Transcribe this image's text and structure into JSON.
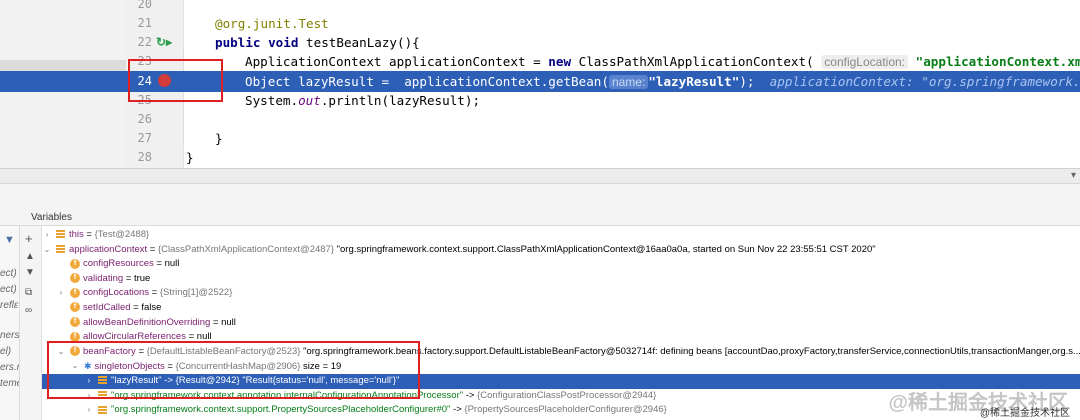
{
  "editor": {
    "lines": [
      {
        "num": "20"
      },
      {
        "num": "21"
      },
      {
        "num": "22"
      },
      {
        "num": "23"
      },
      {
        "num": "24"
      },
      {
        "num": "25"
      },
      {
        "num": "26"
      },
      {
        "num": "27"
      },
      {
        "num": "28"
      }
    ],
    "l21_annotation": "@org.junit.Test",
    "l22_kw1": "public",
    "l22_kw2": "void",
    "l22_rest": "testBeanLazy(){",
    "l23_a": "ApplicationContext applicationContext = ",
    "l23_kw": "new",
    "l23_b": " ClassPathXmlApplicationContext(",
    "l23_hint": "configLocation:",
    "l23_str": "\"applicationContext.xml\"",
    "l23_end": ");",
    "l24_a": "Object lazyResult =  applicationContext.getBean(",
    "l24_hint": "name:",
    "l24_str": "\"lazyResult\"",
    "l24_end": ");",
    "l24_inline": "applicationContext: \"org.springframework.cont",
    "l25_a": "System.",
    "l25_out": "out",
    "l25_b": ".println(lazyResult);",
    "l27": "}",
    "l28": "}"
  },
  "panel": {
    "title": "Variables"
  },
  "frames_fragments": [
    "ect)",
    "ect)",
    "reflε",
    "ners.",
    "el)",
    "ers.n",
    "teme"
  ],
  "variables": [
    {
      "name": "this",
      "type": "{Test@2488}",
      "value": ""
    },
    {
      "name": "applicationContext",
      "type": "{ClassPathXmlApplicationContext@2487}",
      "value": "\"org.springframework.context.support.ClassPathXmlApplicationContext@16aa0a0a, started on Sun Nov 22 23:55:51 CST 2020\""
    },
    {
      "name": "configResources",
      "value": "null"
    },
    {
      "name": "validating",
      "value": "true"
    },
    {
      "name": "configLocations",
      "type": "{String[1]@2522}",
      "value": ""
    },
    {
      "name": "setIdCalled",
      "value": "false"
    },
    {
      "name": "allowBeanDefinitionOverriding",
      "value": "null"
    },
    {
      "name": "allowCircularReferences",
      "value": "null"
    },
    {
      "name": "beanFactory",
      "type": "{DefaultListableBeanFactory@2523}",
      "value": "\"org.springframework.beans.factory.support.DefaultListableBeanFactory@5032714f: defining beans [accountDao,proxyFactory,transferService,connectionUtils,transactionManger,org.s..."
    },
    {
      "name": "singletonObjects",
      "type": "{ConcurrentHashMap@2906}",
      "value": "size = 19"
    },
    {
      "name": "\"lazyResult\"",
      "type": "{Result@2942}",
      "value": "\"Result{status='null', message='null'}\""
    },
    {
      "name": "\"org.springframework.context.annotation.internalConfigurationAnnotationProcessor\"",
      "type": "{ConfigurationClassPostProcessor@2944}",
      "value": ""
    },
    {
      "name": "\"org.springframework.context.support.PropertySourcesPlaceholderConfigurer#0\"",
      "type": "{PropertySourcesPlaceholderConfigurer@2946}",
      "value": ""
    }
  ],
  "watermark": {
    "text": "@稀土掘金技术社区",
    "text2": "@稀土掘金技术社区"
  },
  "colors": {
    "selection": "#2d5fb7",
    "highlight_box": "#e02020",
    "field_icon": "#f2a93b",
    "string_green": "#067d17"
  }
}
